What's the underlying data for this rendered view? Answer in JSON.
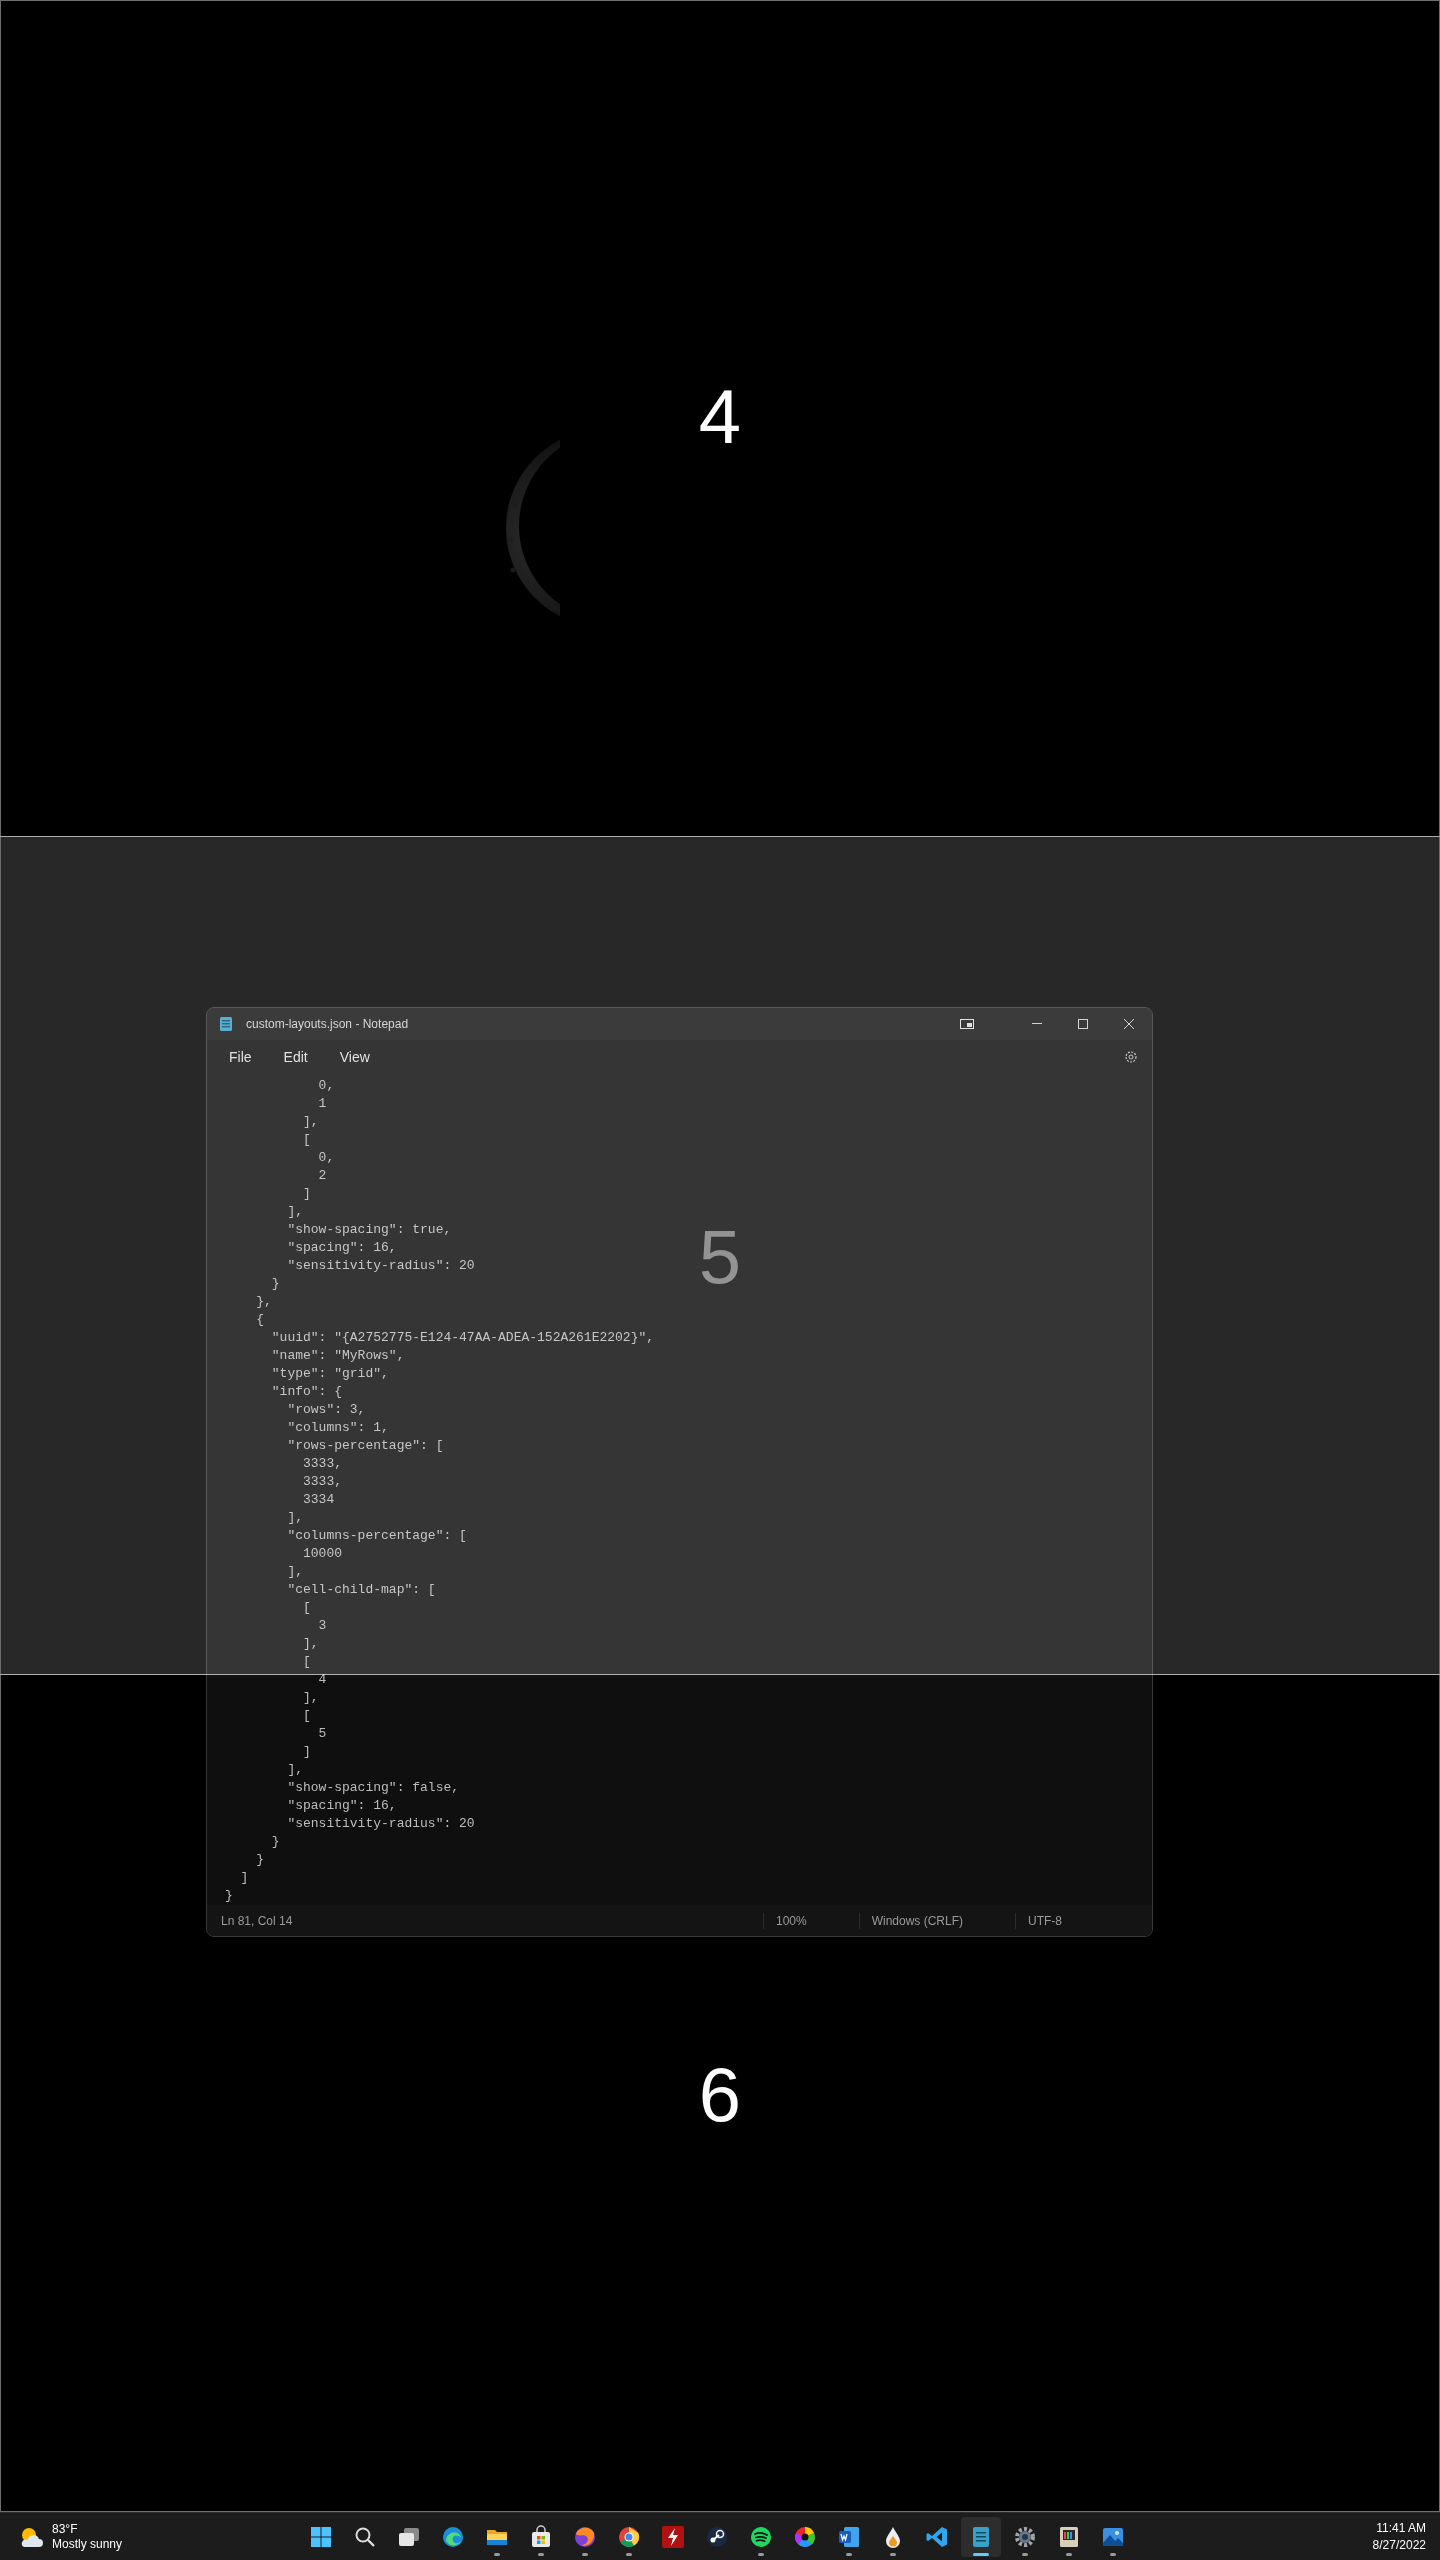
{
  "zones": [
    {
      "number": "4",
      "highlighted": false
    },
    {
      "number": "5",
      "highlighted": true
    },
    {
      "number": "6",
      "highlighted": false
    }
  ],
  "window": {
    "title": "custom-layouts.json - Notepad",
    "menu": [
      "File",
      "Edit",
      "View"
    ],
    "lines": [
      "            0,",
      "            1",
      "          ],",
      "          [",
      "            0,",
      "            2",
      "          ]",
      "        ],",
      "        \"show-spacing\": true,",
      "        \"spacing\": 16,",
      "        \"sensitivity-radius\": 20",
      "      }",
      "    },",
      "    {",
      "      \"uuid\": \"{A2752775-E124-47AA-ADEA-152A261E2202}\",",
      "      \"name\": \"MyRows\",",
      "      \"type\": \"grid\",",
      "      \"info\": {",
      "        \"rows\": 3,",
      "        \"columns\": 1,",
      "        \"rows-percentage\": [",
      "          3333,",
      "          3333,",
      "          3334",
      "        ],",
      "        \"columns-percentage\": [",
      "          10000",
      "        ],",
      "        \"cell-child-map\": [",
      "          [",
      "            3",
      "          ],",
      "          [",
      "            4",
      "          ],",
      "          [",
      "            5",
      "          ]",
      "        ],",
      "        \"show-spacing\": false,",
      "        \"spacing\": 16,",
      "        \"sensitivity-radius\": 20",
      "      }",
      "    }",
      "  ]",
      "}"
    ],
    "status_bar": [
      "Ln 81, Col 14",
      "100%",
      "Windows (CRLF)",
      "UTF-8"
    ]
  },
  "taskbar": {
    "weather": {
      "temperature": "83°F",
      "condition": "Mostly sunny"
    },
    "icons": [
      {
        "kind": "start",
        "running": false,
        "active": false
      },
      {
        "kind": "search",
        "running": false,
        "active": false
      },
      {
        "kind": "taskview",
        "running": false,
        "active": false
      },
      {
        "kind": "swirl",
        "running": false,
        "active": false
      },
      {
        "kind": "folder",
        "running": true,
        "active": false
      },
      {
        "kind": "bag",
        "running": true,
        "active": false
      },
      {
        "kind": "globe",
        "running": true,
        "active": false
      },
      {
        "kind": "wheel",
        "running": true,
        "active": false
      },
      {
        "kind": "bolt",
        "running": false,
        "active": false
      },
      {
        "kind": "link",
        "running": false,
        "active": false
      },
      {
        "kind": "waves",
        "running": true,
        "active": false
      },
      {
        "kind": "colorwheel",
        "running": false,
        "active": false
      },
      {
        "kind": "document",
        "running": true,
        "active": false
      },
      {
        "kind": "droplet",
        "running": true,
        "active": false
      },
      {
        "kind": "ribbon",
        "running": false,
        "active": false
      },
      {
        "kind": "notepad",
        "running": true,
        "active": true
      },
      {
        "kind": "gear",
        "running": true,
        "active": false
      },
      {
        "kind": "monitor",
        "running": true,
        "active": false
      },
      {
        "kind": "landscape",
        "running": true,
        "active": false
      }
    ],
    "time": "11:41 AM",
    "date": "8/27/2022"
  }
}
